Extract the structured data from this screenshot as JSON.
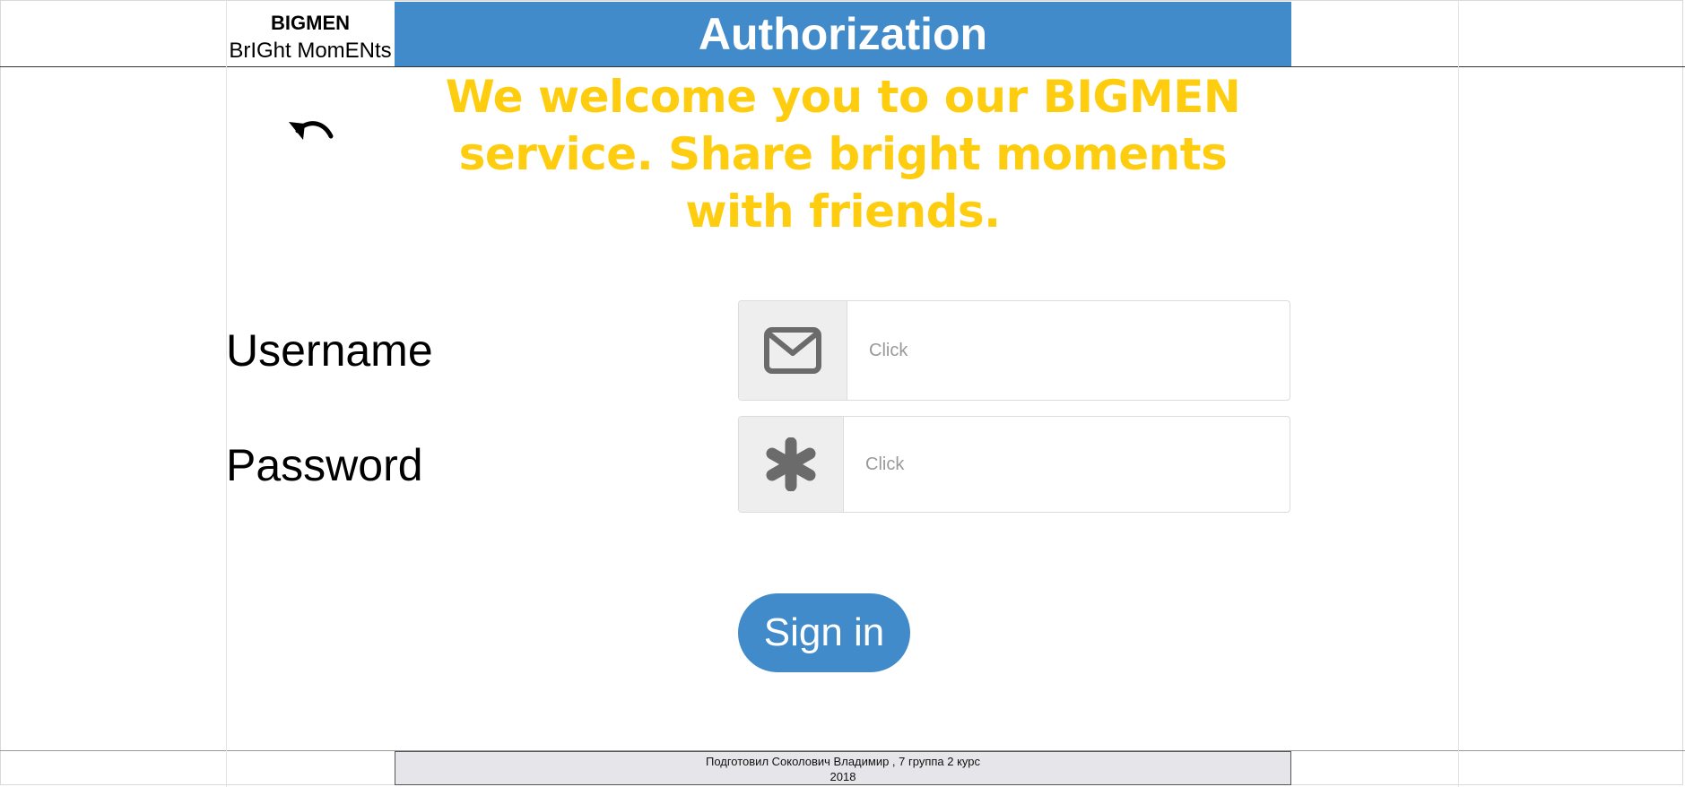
{
  "brand": {
    "title": "BIGMEN",
    "subtitle": "BrIGht MomENts"
  },
  "header": {
    "title": "Authorization"
  },
  "welcome": {
    "text": "We welcome you to our BIGMEN service. Share bright moments with friends."
  },
  "form": {
    "username": {
      "label": "Username",
      "placeholder": "Click",
      "icon": "envelope-icon"
    },
    "password": {
      "label": "Password",
      "placeholder": "Click",
      "icon": "asterisk-icon"
    },
    "submit_label": "Sign in"
  },
  "footer": {
    "line1": "Подготовил Соколович Владимир , 7 группа 2 курс",
    "line2": "2018"
  },
  "colors": {
    "accent": "#418bca",
    "welcome": "#ffcd0f",
    "addon": "#eeeeee",
    "footer_bg": "#e6e6ea"
  }
}
